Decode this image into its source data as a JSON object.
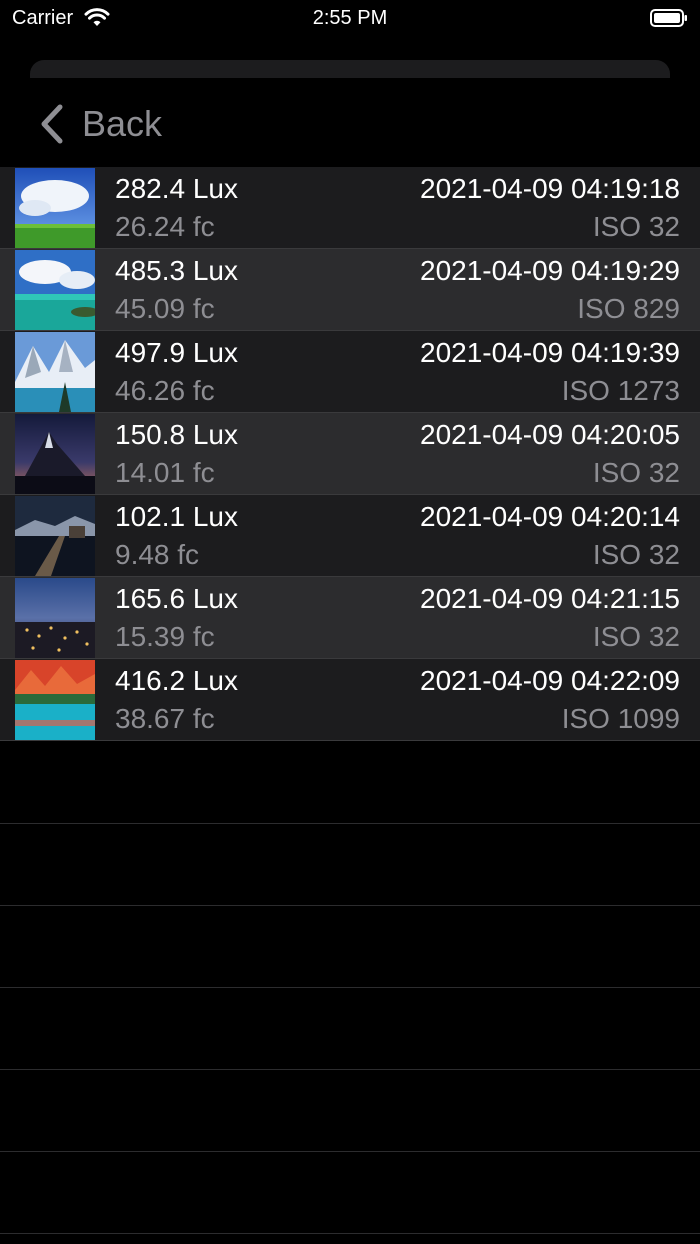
{
  "status_bar": {
    "carrier": "Carrier",
    "time": "2:55 PM"
  },
  "nav": {
    "back_label": "Back"
  },
  "rows": [
    {
      "lux": "282.4 Lux",
      "fc": "26.24 fc",
      "timestamp": "2021-04-09 04:19:18",
      "iso": "ISO 32",
      "thumb": "meadow-clouds"
    },
    {
      "lux": "485.3 Lux",
      "fc": "45.09 fc",
      "timestamp": "2021-04-09 04:19:29",
      "iso": "ISO 829",
      "thumb": "tropical-lagoon"
    },
    {
      "lux": "497.9 Lux",
      "fc": "46.26 fc",
      "timestamp": "2021-04-09 04:19:39",
      "iso": "ISO 1273",
      "thumb": "snowy-mountain-lake"
    },
    {
      "lux": "150.8 Lux",
      "fc": "14.01 fc",
      "timestamp": "2021-04-09 04:20:05",
      "iso": "ISO 32",
      "thumb": "night-peak"
    },
    {
      "lux": "102.1 Lux",
      "fc": "9.48 fc",
      "timestamp": "2021-04-09 04:20:14",
      "iso": "ISO 32",
      "thumb": "pier-dusk"
    },
    {
      "lux": "165.6 Lux",
      "fc": "15.39 fc",
      "timestamp": "2021-04-09 04:21:15",
      "iso": "ISO 32",
      "thumb": "city-night"
    },
    {
      "lux": "416.2 Lux",
      "fc": "38.67 fc",
      "timestamp": "2021-04-09 04:22:09",
      "iso": "ISO 1099",
      "thumb": "autumn-lake"
    }
  ]
}
